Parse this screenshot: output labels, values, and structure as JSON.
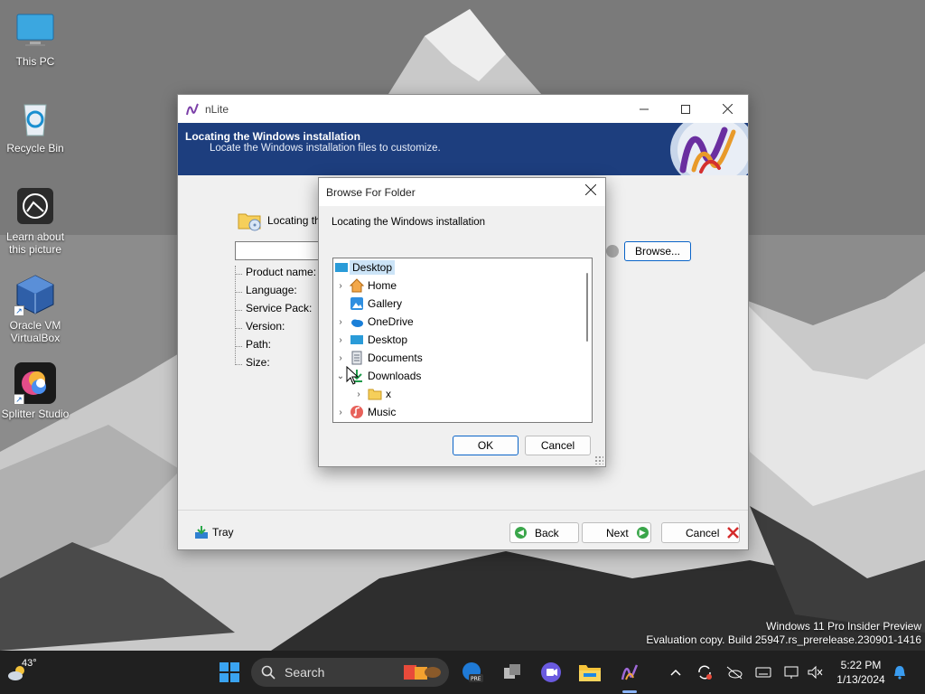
{
  "desktop": {
    "icons": [
      {
        "label": "This PC"
      },
      {
        "label": "Recycle Bin"
      },
      {
        "label": "Learn about\nthis picture"
      },
      {
        "label": "Oracle VM\nVirtualBox"
      },
      {
        "label": "Splitter Studio"
      }
    ],
    "watermark_line1": "Windows 11 Pro Insider Preview",
    "watermark_line2": "Evaluation copy. Build 25947.rs_prerelease.230901-1416"
  },
  "nlite": {
    "title": "nLite",
    "header_title": "Locating the Windows installation",
    "header_subtitle": "Locate the Windows installation files to customize.",
    "locating_label": "Locating the",
    "info_labels": [
      "Product name:",
      "Language:",
      "Service Pack:",
      "Version:",
      "Path:",
      "Size:"
    ],
    "browse_label": "Browse...",
    "tray_label": "Tray",
    "back_label": "Back",
    "next_label": "Next",
    "cancel_label": "Cancel"
  },
  "dialog": {
    "title": "Browse For Folder",
    "message": "Locating the Windows installation",
    "tree": [
      {
        "label": "Desktop",
        "icon": "desktop-icon",
        "selected": true
      },
      {
        "label": "Home",
        "icon": "home-icon"
      },
      {
        "label": "Gallery",
        "icon": "gallery-icon"
      },
      {
        "label": "OneDrive",
        "icon": "onedrive-icon"
      },
      {
        "label": "Desktop",
        "icon": "desktop-icon"
      },
      {
        "label": "Documents",
        "icon": "documents-icon"
      },
      {
        "label": "Downloads",
        "icon": "downloads-icon",
        "expanded": true
      },
      {
        "label": "x",
        "icon": "folder-icon"
      },
      {
        "label": "Music",
        "icon": "music-icon"
      }
    ],
    "ok_label": "OK",
    "cancel_label": "Cancel"
  },
  "taskbar": {
    "weather_temp": "43°",
    "search_placeholder": "Search",
    "time": "5:22 PM",
    "date": "1/13/2024"
  },
  "colors": {
    "header_blue": "#1d3e7e",
    "accent": "#0a64c8",
    "selection": "#cce4f7"
  }
}
